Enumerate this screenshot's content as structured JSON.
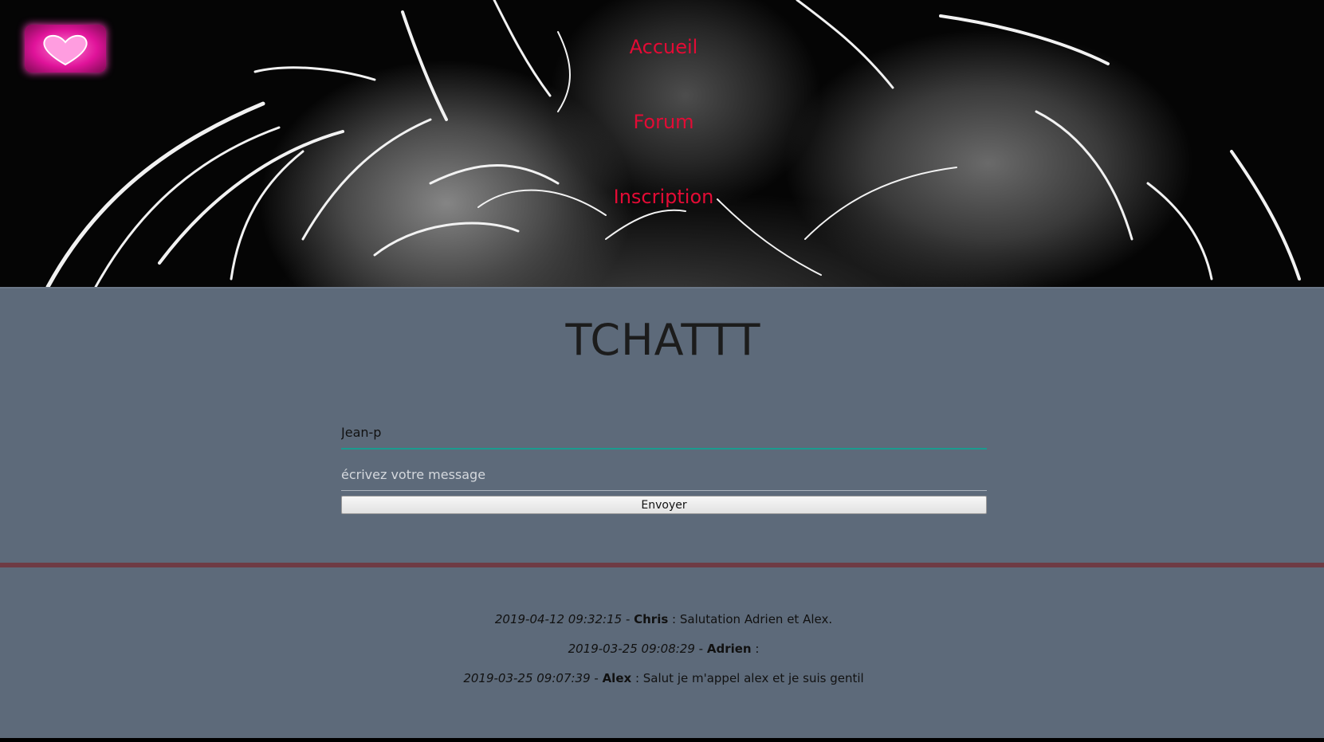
{
  "header": {
    "logo_name": "heart-logo",
    "nav": [
      {
        "label": "Accueil"
      },
      {
        "label": "Forum"
      },
      {
        "label": "Inscription"
      }
    ]
  },
  "main": {
    "title": "TCHATTT",
    "pseudo_value": "Jean-p",
    "message_placeholder": "écrivez votre message",
    "send_label": "Envoyer"
  },
  "messages": [
    {
      "date": "2019-04-12 09:32:15",
      "sep": " - ",
      "author": "Chris",
      "colon": " : ",
      "text": "Salutation Adrien et Alex."
    },
    {
      "date": "2019-03-25 09:08:29",
      "sep": " - ",
      "author": "Adrien",
      "colon": " : ",
      "text": ""
    },
    {
      "date": "2019-03-25 09:07:39",
      "sep": " - ",
      "author": "Alex",
      "colon": " : ",
      "text": "Salut je m'appel alex et je suis gentil"
    }
  ],
  "colors": {
    "nav_link": "#e30b35",
    "main_bg": "#5d6a7a",
    "divider": "#6e3b44",
    "input_focus": "#1a9b8f"
  }
}
